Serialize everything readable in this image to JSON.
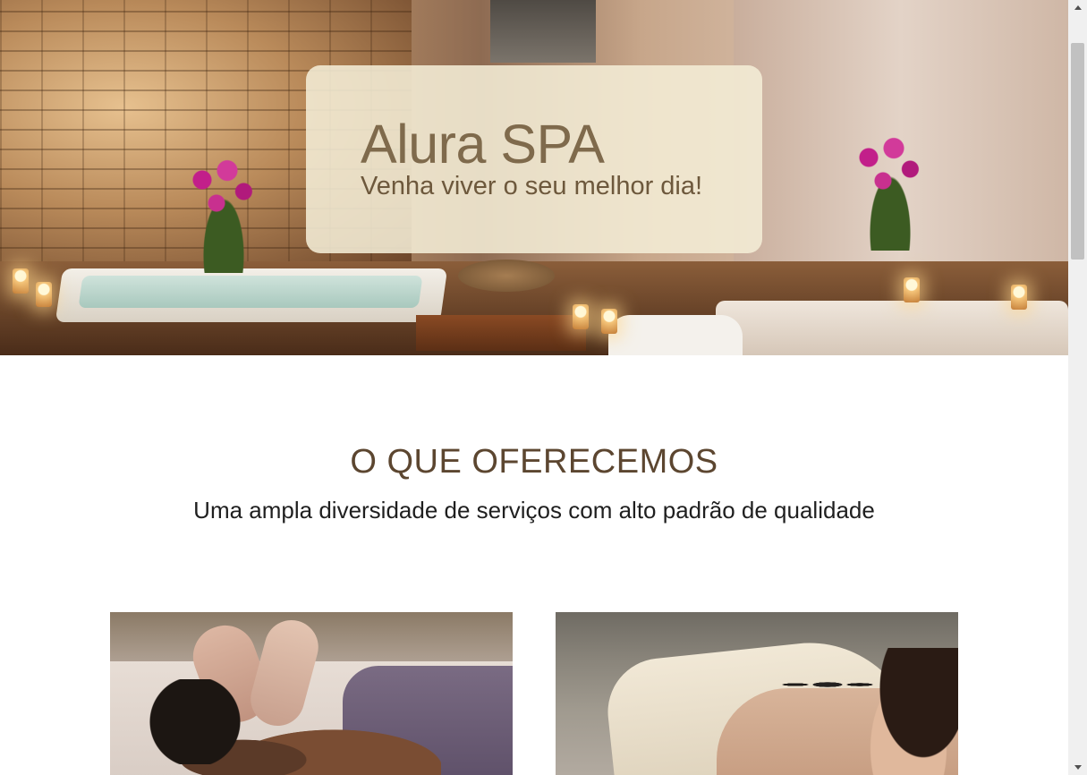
{
  "hero": {
    "title": "Alura SPA",
    "subtitle": "Venha viver o seu melhor dia!"
  },
  "services_section": {
    "title": "O QUE OFERECEMOS",
    "subtitle": "Uma ampla diversidade de serviços com alto padrão de qualidade"
  },
  "colors": {
    "hero_card_bg": "#f4edd6",
    "hero_title": "#7f6a4c",
    "section_title": "#5c4630",
    "body_text": "#1f1f1f"
  },
  "icons": {
    "scroll_up": "triangle-up-icon",
    "scroll_down": "triangle-down-icon"
  }
}
